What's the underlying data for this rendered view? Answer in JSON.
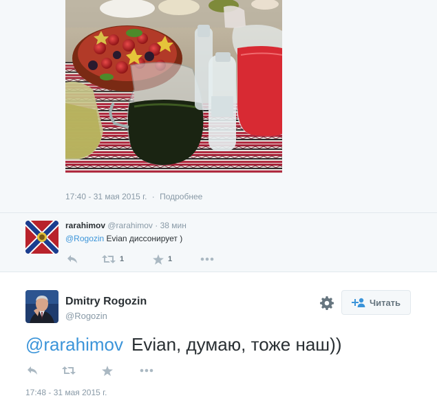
{
  "original_tweet": {
    "timestamp": "17:40 - 31 мая 2015 г.",
    "separator": "·",
    "details_link": "Подробнее"
  },
  "reply": {
    "display_name": "rarahimov",
    "handle": "@rarahimov",
    "separator": "·",
    "time_ago": "38 мин",
    "mention": "@Rogozin",
    "text": " Evian диссонирует )",
    "retweet_count": "1",
    "like_count": "1"
  },
  "main_tweet": {
    "display_name": "Dmitry Rogozin",
    "handle": "@Rogozin",
    "follow_label": "Читать",
    "mention": "@rarahimov",
    "text": "Evian, думаю, тоже наш))",
    "timestamp": "17:48 - 31 мая 2015 г."
  },
  "icons": {
    "reply": "reply-icon",
    "retweet": "retweet-icon",
    "like": "star-icon",
    "more": "more-icon",
    "settings": "gear-icon",
    "follow": "add-user-icon"
  },
  "colors": {
    "link": "#3b94d9",
    "muted": "#8899a6",
    "action_icon": "#aab8c2",
    "reply_background": "#f5f8fa"
  }
}
